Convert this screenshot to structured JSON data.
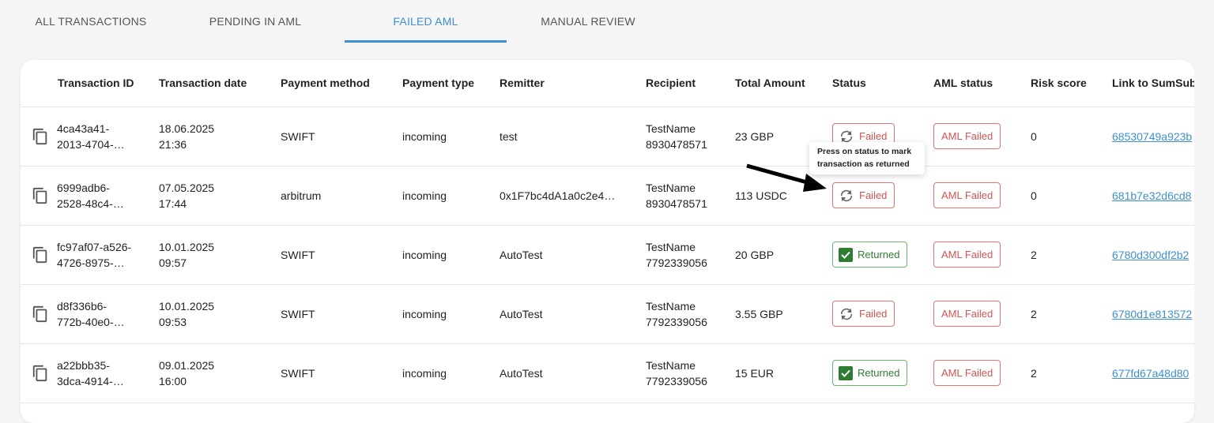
{
  "tabs": [
    {
      "label": "ALL TRANSACTIONS",
      "active": false
    },
    {
      "label": "PENDING IN AML",
      "active": false
    },
    {
      "label": "FAILED AML",
      "active": true
    },
    {
      "label": "MANUAL REVIEW",
      "active": false
    }
  ],
  "columns": [
    "Transaction ID",
    "Transaction date",
    "Payment method",
    "Payment type",
    "Remitter",
    "Recipient",
    "Total Amount",
    "Status",
    "AML status",
    "Risk score",
    "Link to SumSub"
  ],
  "rows": [
    {
      "id1": "4ca43a41-",
      "id2": "2013-4704-…",
      "date": "18.06.2025",
      "time": "21:36",
      "method": "SWIFT",
      "type": "incoming",
      "remitter": "test",
      "recipient_name": "TestName",
      "recipient_id": "8930478571",
      "amount": "23 GBP",
      "status": "Failed",
      "aml": "AML Failed",
      "risk": "0",
      "link": "68530749a923b"
    },
    {
      "id1": "6999adb6-",
      "id2": "2528-48c4-…",
      "date": "07.05.2025",
      "time": "17:44",
      "method": "arbitrum",
      "type": "incoming",
      "remitter": "0x1F7bc4dA1a0c2e4…",
      "recipient_name": "TestName",
      "recipient_id": "8930478571",
      "amount": "113 USDC",
      "status": "Failed",
      "aml": "AML Failed",
      "risk": "0",
      "link": "681b7e32d6cd8"
    },
    {
      "id1": "fc97af07-a526-",
      "id2": "4726-8975-…",
      "date": "10.01.2025",
      "time": "09:57",
      "method": "SWIFT",
      "type": "incoming",
      "remitter": "AutoTest",
      "recipient_name": "TestName",
      "recipient_id": "7792339056",
      "amount": "20 GBP",
      "status": "Returned",
      "aml": "AML Failed",
      "risk": "2",
      "link": "6780d300df2b2"
    },
    {
      "id1": "d8f336b6-",
      "id2": "772b-40e0-…",
      "date": "10.01.2025",
      "time": "09:53",
      "method": "SWIFT",
      "type": "incoming",
      "remitter": "AutoTest",
      "recipient_name": "TestName",
      "recipient_id": "7792339056",
      "amount": "3.55 GBP",
      "status": "Failed",
      "aml": "AML Failed",
      "risk": "2",
      "link": "6780d1e813572"
    },
    {
      "id1": "a22bbb35-",
      "id2": "3dca-4914-…",
      "date": "09.01.2025",
      "time": "16:00",
      "method": "SWIFT",
      "type": "incoming",
      "remitter": "AutoTest",
      "recipient_name": "TestName",
      "recipient_id": "7792339056",
      "amount": "15 EUR",
      "status": "Returned",
      "aml": "AML Failed",
      "risk": "2",
      "link": "677fd67a48d80"
    }
  ],
  "tooltip": {
    "text": "Press on status to mark transaction as returned"
  },
  "colors": {
    "accent": "#3d8fd8",
    "failed": "#d9534f",
    "returned": "#2e7d32"
  }
}
